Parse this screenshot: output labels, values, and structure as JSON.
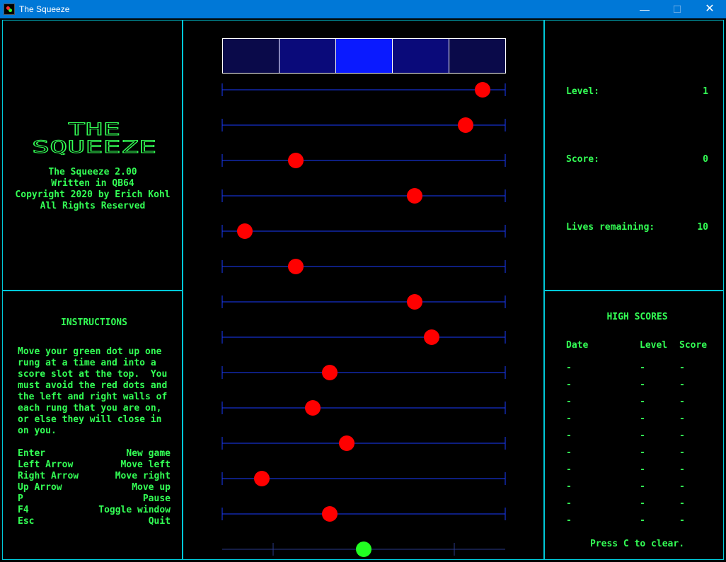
{
  "window": {
    "title": "The Squeeze",
    "minimize": "—",
    "maximize": "☐",
    "close": "✕"
  },
  "left_top": {
    "logo": "THE SQUEEZE",
    "credits": [
      "The Squeeze 2.00",
      "Written in QB64",
      "Copyright 2020 by Erich Kohl",
      "All Rights Reserved"
    ]
  },
  "instructions": {
    "heading": "INSTRUCTIONS",
    "paragraph": [
      "Move your green dot up one",
      "rung at a time and into a",
      "score slot at the top.  You",
      "must avoid the red dots and",
      "the left and right walls of",
      "each rung that you are on,",
      "or else they will close in",
      "on you."
    ],
    "keys": [
      {
        "key": "Enter",
        "action": "New game"
      },
      {
        "key": "Left Arrow",
        "action": "Move left"
      },
      {
        "key": "Right Arrow",
        "action": "Move right"
      },
      {
        "key": "Up Arrow",
        "action": "Move up"
      },
      {
        "key": "P",
        "action": "Pause"
      },
      {
        "key": "F4",
        "action": "Toggle window"
      },
      {
        "key": "Esc",
        "action": "Quit"
      }
    ]
  },
  "stats": {
    "level_label": "Level:",
    "level_value": "1",
    "score_label": "Score:",
    "score_value": "0",
    "lives_label": "Lives remaining:",
    "lives_value": "10"
  },
  "high_scores": {
    "heading": "HIGH SCORES",
    "col_date": "Date",
    "col_level": "Level",
    "col_score": "Score",
    "rows": [
      [
        "-",
        "-",
        "-"
      ],
      [
        "-",
        "-",
        "-"
      ],
      [
        "-",
        "-",
        "-"
      ],
      [
        "-",
        "-",
        "-"
      ],
      [
        "-",
        "-",
        "-"
      ],
      [
        "-",
        "-",
        "-"
      ],
      [
        "-",
        "-",
        "-"
      ],
      [
        "-",
        "-",
        "-"
      ],
      [
        "-",
        "-",
        "-"
      ],
      [
        "-",
        "-",
        "-"
      ]
    ],
    "footer": "Press C to clear."
  },
  "game": {
    "score_slots": [
      "#0a0a4a",
      "#0a0a7a",
      "#0a1aff",
      "#0a0a7a",
      "#0a0a4a"
    ],
    "red_dot_positions": [
      0.92,
      0.86,
      0.26,
      0.68,
      0.08,
      0.26,
      0.68,
      0.74,
      0.38,
      0.32,
      0.44,
      0.14,
      0.38
    ],
    "player_position": 0.5,
    "colors": {
      "accent": "#00c8d8",
      "text": "#33ff55",
      "rung": "#1a3cff",
      "enemy": "#ff0000",
      "player": "#22ff22"
    }
  }
}
